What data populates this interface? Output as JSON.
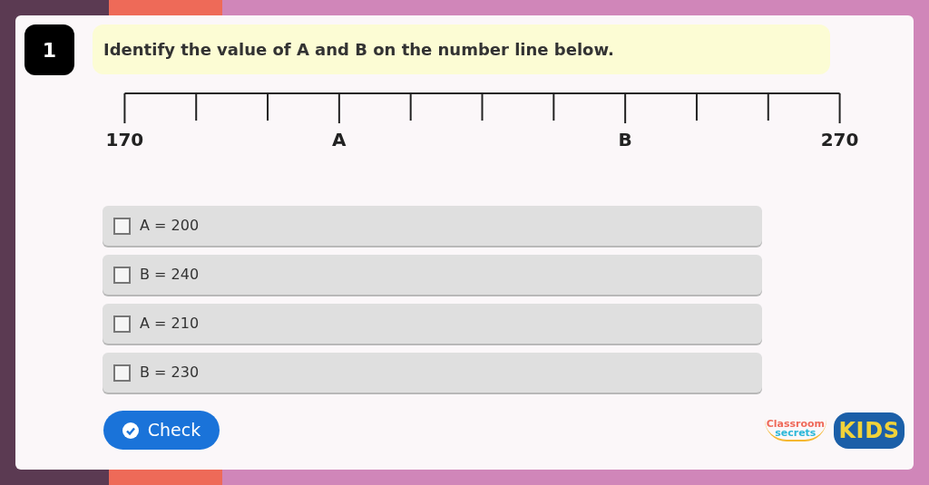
{
  "question": {
    "number": "1",
    "text": "Identify the value of A and B on the number line below."
  },
  "number_line": {
    "ticks": [
      {
        "kind": "labeled",
        "label": "170"
      },
      {
        "kind": "plain"
      },
      {
        "kind": "plain"
      },
      {
        "kind": "labeled",
        "label": "A"
      },
      {
        "kind": "plain"
      },
      {
        "kind": "plain"
      },
      {
        "kind": "plain"
      },
      {
        "kind": "labeled",
        "label": "B"
      },
      {
        "kind": "plain"
      },
      {
        "kind": "plain"
      },
      {
        "kind": "labeled",
        "label": "270"
      }
    ]
  },
  "options": [
    {
      "label": "A = 200",
      "checked": false
    },
    {
      "label": "B = 240",
      "checked": false
    },
    {
      "label": "A = 210",
      "checked": false
    },
    {
      "label": "B = 230",
      "checked": false
    }
  ],
  "check_button": {
    "label": "Check"
  },
  "logo": {
    "line_1": "Classroom",
    "line_2": "secrets",
    "badge": "KIDS"
  }
}
